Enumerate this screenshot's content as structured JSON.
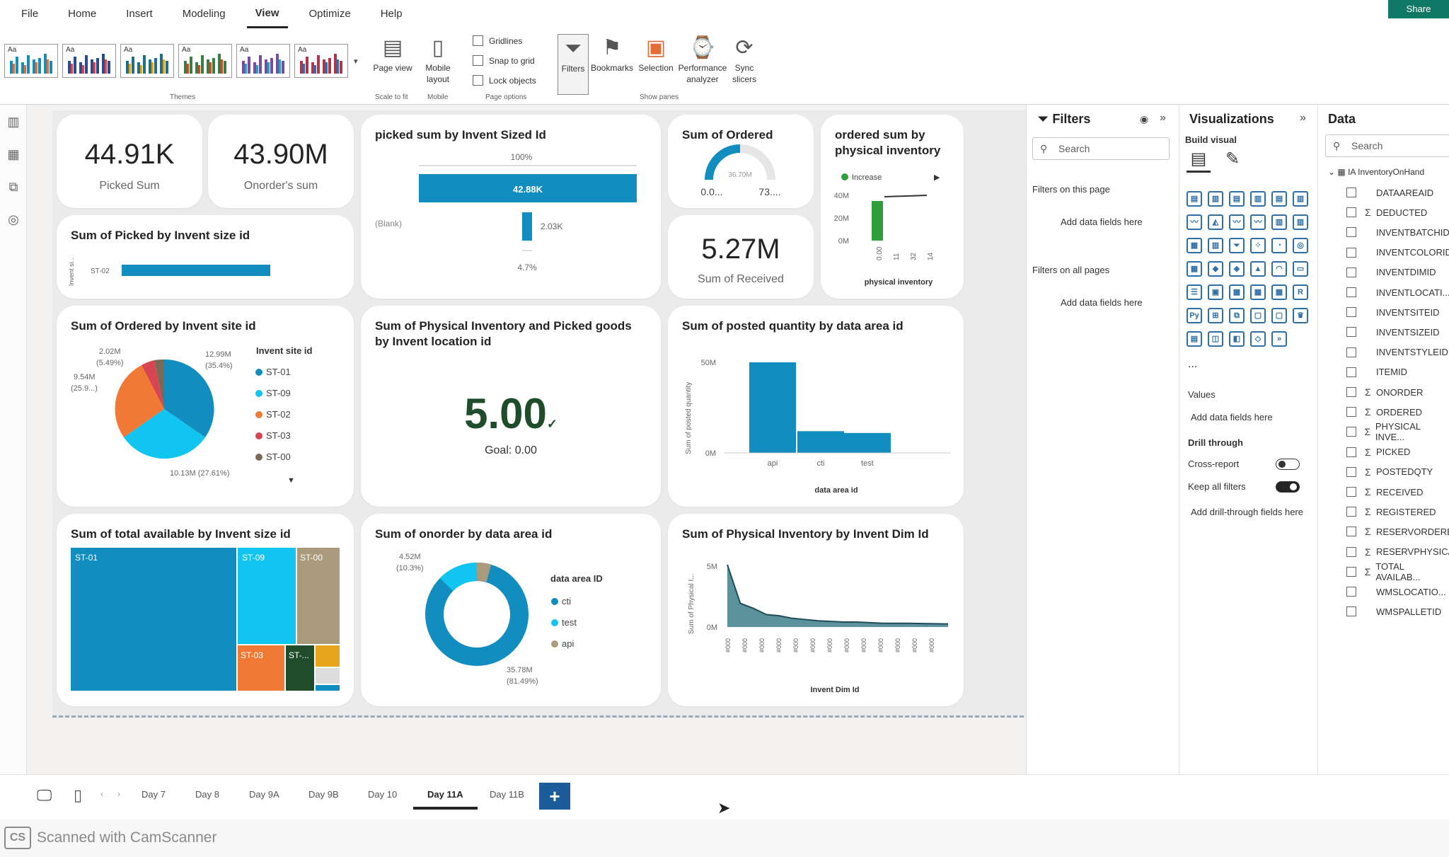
{
  "menu": {
    "items": [
      "File",
      "Home",
      "Insert",
      "Modeling",
      "View",
      "Optimize",
      "Help"
    ],
    "active": "View",
    "share_label": "Share"
  },
  "ribbon": {
    "theme_label": "Themes",
    "theme_thumb_label": "Aa",
    "page_view": "Page view",
    "mobile_layout": "Mobile layout",
    "scale_group": "Scale to fit",
    "mobile_group": "Mobile",
    "checkboxes": [
      "Gridlines",
      "Snap to grid",
      "Lock objects"
    ],
    "page_options_group": "Page options",
    "filters": "Filters",
    "bookmarks": "Bookmarks",
    "selection": "Selection",
    "performance": "Performance analyzer",
    "sync": "Sync slicers",
    "show_panes_group": "Show panes"
  },
  "kpis": {
    "picked_value": "44.91K",
    "picked_label": "Picked Sum",
    "onorder_value": "43.90M",
    "onorder_label": "Onorder's sum",
    "received_value": "5.27M",
    "received_label": "Sum of Received"
  },
  "picked_by_size": {
    "title": "Sum of Picked by Invent size id",
    "ylabel": "Invent si...",
    "category": "ST-02"
  },
  "funnel": {
    "title": "picked sum by Invent Sized Id",
    "top_pct": "100%",
    "bar1_label": "42.88K",
    "bar2_category": "(Blank)",
    "bar2_label": "2.03K",
    "bottom_pct": "4.7%"
  },
  "gauge": {
    "title": "Sum of Ordered",
    "center": "36.70M",
    "min": "0.0...",
    "max": "73...."
  },
  "waterfall": {
    "title": "ordered sum by physical inventory",
    "legend": "Increase",
    "yticks": [
      "40M",
      "20M",
      "0M"
    ],
    "xticks": [
      "0.00",
      "11",
      "32",
      "14"
    ],
    "xlabel": "physical inventory"
  },
  "pie": {
    "title": "Sum of Ordered by Invent site id",
    "legend_title": "Invent site id",
    "labels": {
      "a": "2.02M",
      "a_pct": "(5.49%)",
      "b": "9.54M",
      "b_pct": "(25.9...)",
      "c": "12.99M",
      "c_pct": "(35.4%)",
      "d": "10.13M (27.61%)"
    }
  },
  "kpi_goal": {
    "title": "Sum of Physical Inventory and Picked goods by Invent location id",
    "value": "5.00",
    "goal": "Goal: 0.00"
  },
  "posted_bar": {
    "title": "Sum of posted quantity by data area id",
    "ylabel": "Sum of posted quantity",
    "xlabel": "data area id",
    "yticks": [
      "50M",
      "0M"
    ]
  },
  "treemap": {
    "title": "Sum of total available by Invent size id",
    "labels": [
      "ST-01",
      "ST-09",
      "ST-00",
      "ST-03",
      "ST-..."
    ]
  },
  "donut": {
    "title": "Sum of onorder by data area id",
    "legend_title": "data area ID",
    "label_small": "4.52M",
    "label_small_pct": "(10.3%)",
    "label_big": "35.78M",
    "label_big_pct": "(81.49%)"
  },
  "area": {
    "title": "Sum of Physical Inventory by Invent Dim Id",
    "ylabel": "Sum of Physical I...",
    "xlabel": "Invent Dim Id",
    "yticks": [
      "5M",
      "0M"
    ],
    "xtick": "#000"
  },
  "filters_pane": {
    "title": "Filters",
    "search": "Search",
    "on_page": "Filters on this page",
    "add1": "Add data fields here",
    "all_pages": "Filters on all pages",
    "add2": "Add data fields here"
  },
  "viz_pane": {
    "title": "Visualizations",
    "build": "Build visual",
    "more": "...",
    "values": "Values",
    "add_values": "Add data fields here",
    "drill": "Drill through",
    "cross": "Cross-report",
    "cross_state": "Off",
    "keep": "Keep all filters",
    "keep_state": "On",
    "add_drill": "Add drill-through fields here"
  },
  "data_pane": {
    "title": "Data",
    "search": "Search",
    "table": "IA InventoryOnHand",
    "fields": [
      {
        "name": "DATAAREAID",
        "sigma": false
      },
      {
        "name": "DEDUCTED",
        "sigma": true
      },
      {
        "name": "INVENTBATCHID",
        "sigma": false
      },
      {
        "name": "INVENTCOLORID",
        "sigma": false
      },
      {
        "name": "INVENTDIMID",
        "sigma": false
      },
      {
        "name": "INVENTLOCATI...",
        "sigma": false
      },
      {
        "name": "INVENTSITEID",
        "sigma": false
      },
      {
        "name": "INVENTSIZEID",
        "sigma": false
      },
      {
        "name": "INVENTSTYLEID",
        "sigma": false
      },
      {
        "name": "ITEMID",
        "sigma": false
      },
      {
        "name": "ONORDER",
        "sigma": true
      },
      {
        "name": "ORDERED",
        "sigma": true
      },
      {
        "name": "PHYSICAL INVE...",
        "sigma": true
      },
      {
        "name": "PICKED",
        "sigma": true
      },
      {
        "name": "POSTEDQTY",
        "sigma": true
      },
      {
        "name": "RECEIVED",
        "sigma": true
      },
      {
        "name": "REGISTERED",
        "sigma": true
      },
      {
        "name": "RESERVORDERED",
        "sigma": true
      },
      {
        "name": "RESERVPHYSICAL",
        "sigma": true
      },
      {
        "name": "TOTAL AVAILAB...",
        "sigma": true
      },
      {
        "name": "WMSLOCATIO...",
        "sigma": false
      },
      {
        "name": "WMSPALLETID",
        "sigma": false
      }
    ]
  },
  "pages": {
    "tabs": [
      "Day 7",
      "Day 8",
      "Day 9A",
      "Day 9B",
      "Day 10",
      "Day 11A",
      "Day 11B"
    ],
    "active": "Day 11A",
    "add": "+"
  },
  "scanner": {
    "logo": "CS",
    "text": "Scanned with CamScanner"
  },
  "colors": {
    "primary": "#118DBF",
    "cyan": "#12C5F0",
    "orange": "#F07A35",
    "dark_red": "#D64550",
    "brown": "#A89A7A",
    "tan": "#C7A57A",
    "green": "#2E9F3A",
    "dark_green": "#1F4D2C",
    "gold": "#E6A51C",
    "teal_dark": "#3F7F8A"
  },
  "chart_data": [
    {
      "type": "bar",
      "title": "Sum of Picked by Invent size id",
      "categories": [
        "ST-02"
      ],
      "values": [
        42880
      ]
    },
    {
      "type": "bar",
      "title": "picked sum by Invent Sized Id",
      "categories": [
        "",
        "(Blank)"
      ],
      "values": [
        42880,
        2030
      ]
    },
    {
      "type": "pie",
      "title": "Sum of Ordered by Invent site id",
      "categories": [
        "ST-01",
        "ST-09",
        "ST-02",
        "ST-03",
        "ST-00"
      ],
      "values": [
        12.99,
        10.13,
        9.54,
        2.02,
        0.6
      ]
    },
    {
      "type": "bar",
      "title": "Sum of posted quantity by data area id",
      "categories": [
        "api",
        "cti",
        "test"
      ],
      "values": [
        50,
        12,
        11
      ],
      "ylim": [
        0,
        50
      ]
    },
    {
      "type": "pie",
      "title": "Sum of onorder by data area id",
      "categories": [
        "cti",
        "test",
        "api"
      ],
      "values": [
        35.78,
        4.52,
        3.6
      ]
    },
    {
      "type": "area",
      "title": "Sum of Physical Inventory by Invent Dim Id",
      "values": [
        5.2,
        1.9,
        1.5,
        1.0,
        0.9,
        0.7,
        0.6,
        0.5,
        0.45,
        0.4,
        0.4,
        0.35,
        0.3,
        0.3,
        0.3,
        0.28,
        0.26,
        0.25
      ],
      "ylim": [
        0,
        5
      ]
    },
    {
      "type": "bar",
      "title": "ordered sum by physical inventory",
      "categories": [
        "0.00",
        "11",
        "32",
        "14"
      ],
      "values": [
        36,
        4,
        0.3,
        0.2
      ],
      "yticks": [
        "40M",
        "20M",
        "0M"
      ]
    }
  ]
}
